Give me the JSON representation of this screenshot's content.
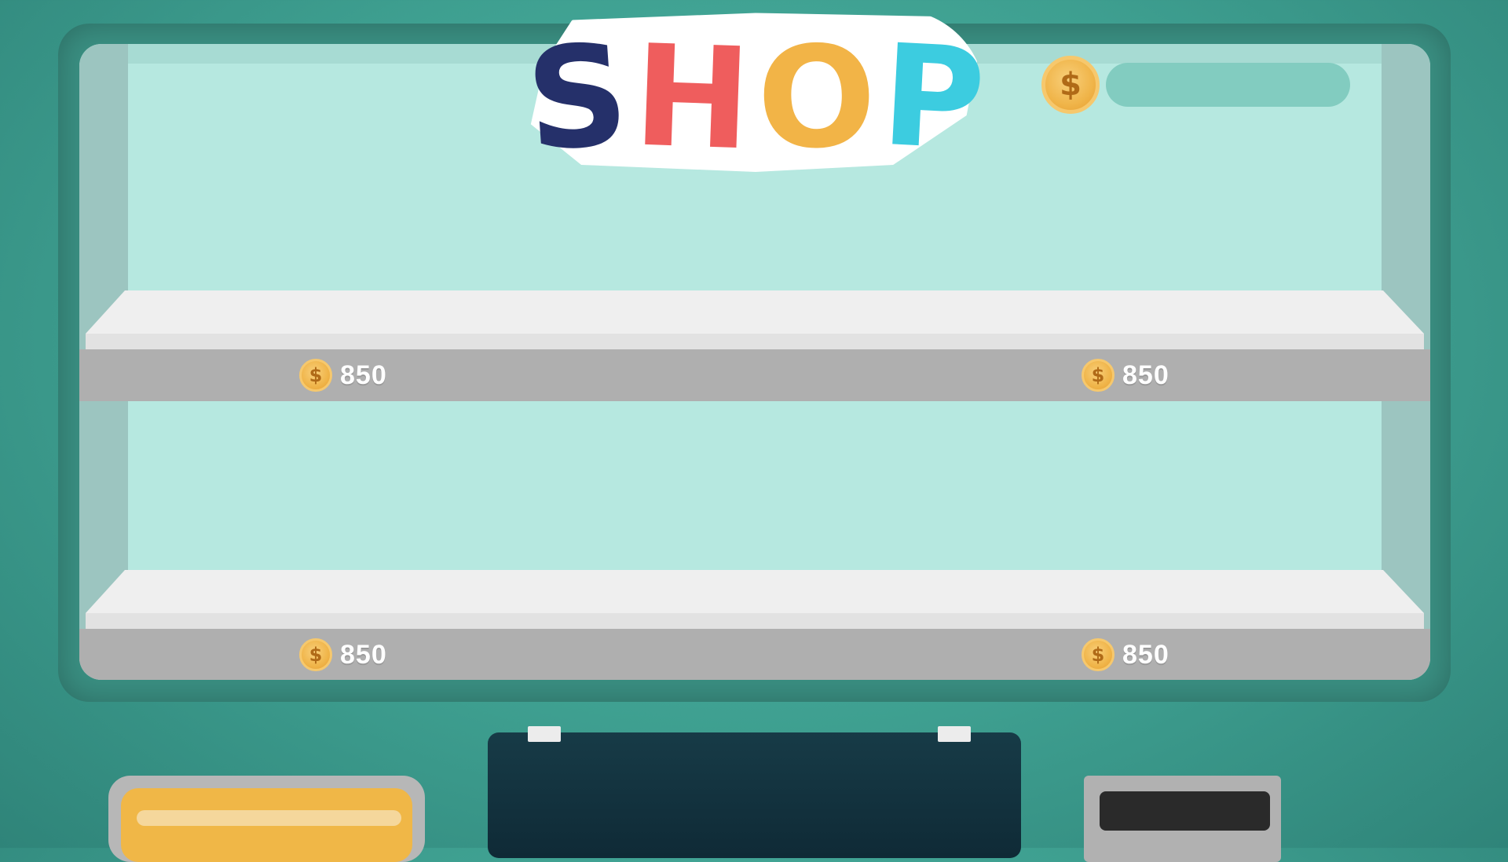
{
  "title": {
    "letters": [
      "S",
      "H",
      "O",
      "P"
    ]
  },
  "balance": {
    "value": ""
  },
  "coin_icon": "$",
  "shelves": [
    {
      "prices": [
        "850",
        "850"
      ]
    },
    {
      "prices": [
        "850",
        "850"
      ]
    }
  ],
  "colors": {
    "title_s": "#25306a",
    "title_h": "#ef5d5d",
    "title_o": "#f2b447",
    "title_p": "#3ccce0",
    "coin": "#f0b54a",
    "background": "#3e9f90"
  }
}
